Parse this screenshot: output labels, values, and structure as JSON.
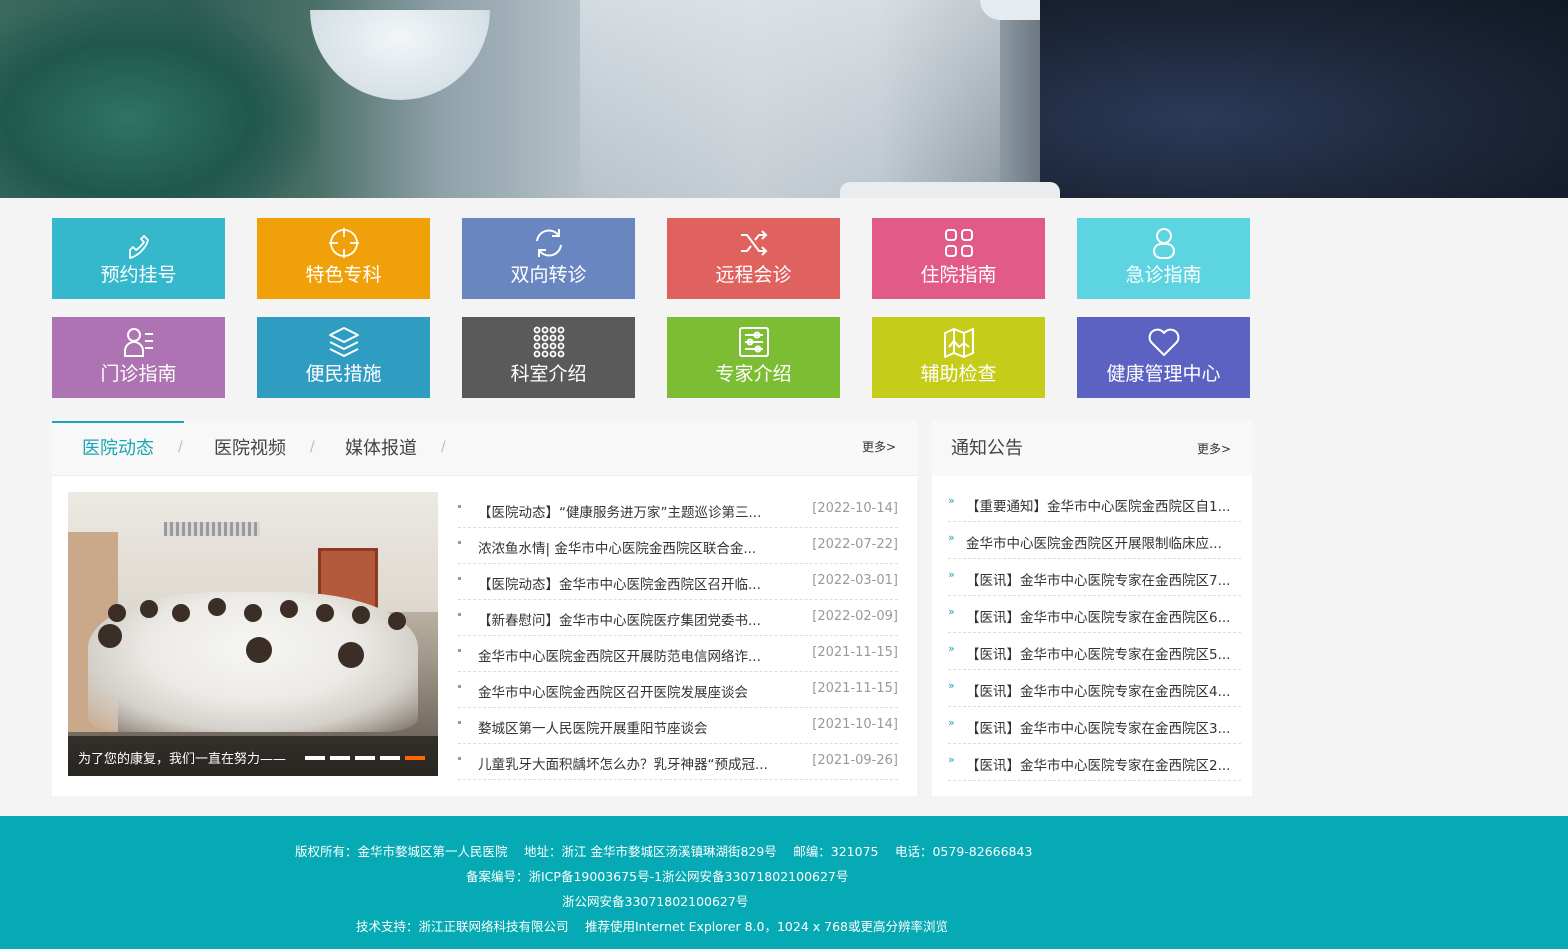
{
  "tiles": [
    {
      "label": "预约挂号",
      "icon": "phone-icon",
      "color": "#35b7cc"
    },
    {
      "label": "特色专科",
      "icon": "crosshair-icon",
      "color": "#f0a10a"
    },
    {
      "label": "双向转诊",
      "icon": "refresh-icon",
      "color": "#6a86c0"
    },
    {
      "label": "远程会诊",
      "icon": "shuffle-icon",
      "color": "#e0625f"
    },
    {
      "label": "住院指南",
      "icon": "grid-icon",
      "color": "#e25b88"
    },
    {
      "label": "急诊指南",
      "icon": "person-icon",
      "color": "#5cd5e0"
    },
    {
      "label": "门诊指南",
      "icon": "user-list-icon",
      "color": "#ad73b2"
    },
    {
      "label": "便民措施",
      "icon": "layers-icon",
      "color": "#2f9cc1"
    },
    {
      "label": "科室介绍",
      "icon": "dots-grid-icon",
      "color": "#5a5a5a"
    },
    {
      "label": "专家介绍",
      "icon": "sliders-icon",
      "color": "#7cbd33"
    },
    {
      "label": "辅助检查",
      "icon": "map-icon",
      "color": "#c5cc1a"
    },
    {
      "label": "健康管理中心",
      "icon": "heart-icon",
      "color": "#5b62c2"
    }
  ],
  "news": {
    "tabs": [
      "医院动态",
      "医院视频",
      "媒体报道"
    ],
    "more": "更多>",
    "slider_caption": "为了您的康复，我们一直在努力——",
    "items": [
      {
        "title": "【医院动态】“健康服务进万家”主题巡诊第三...",
        "date": "[2022-10-14]"
      },
      {
        "title": "浓浓鱼水情| 金华市中心医院金西院区联合金...",
        "date": "[2022-07-22]"
      },
      {
        "title": "【医院动态】金华市中心医院金西院区召开临...",
        "date": "[2022-03-01]"
      },
      {
        "title": "【新春慰问】金华市中心医院医疗集团党委书...",
        "date": "[2022-02-09]"
      },
      {
        "title": "金华市中心医院金西院区开展防范电信网络诈...",
        "date": "[2021-11-15]"
      },
      {
        "title": "金华市中心医院金西院区召开医院发展座谈会",
        "date": "[2021-11-15]"
      },
      {
        "title": "婺城区第一人民医院开展重阳节座谈会",
        "date": "[2021-10-14]"
      },
      {
        "title": "儿童乳牙大面积龋坏怎么办？乳牙神器“预成冠...",
        "date": "[2021-09-26]"
      }
    ]
  },
  "notice": {
    "title": "通知公告",
    "more": "更多>",
    "items": [
      "【重要通知】金华市中心医院金西院区自1...",
      "金华市中心医院金西院区开展限制临床应...",
      "【医讯】金华市中心医院专家在金西院区7...",
      "【医讯】金华市中心医院专家在金西院区6...",
      "【医讯】金华市中心医院专家在金西院区5...",
      "【医讯】金华市中心医院专家在金西院区4...",
      "【医讯】金华市中心医院专家在金西院区3...",
      "【医讯】金华市中心医院专家在金西院区2..."
    ]
  },
  "footer": {
    "line1": "版权所有：金华市婺城区第一人民医院　 地址：浙江 金华市婺城区汤溪镇琳湖街829号　 邮编：321075　 电话：0579-82666843",
    "line2": "备案编号：浙ICP备19003675号-1浙公网安备33071802100627号",
    "line3": "浙公网安备33071802100627号",
    "line4": "技术支持：浙江正联网络科技有限公司　 推荐使用Internet Explorer 8.0，1024 x 768或更高分辨率浏览"
  }
}
